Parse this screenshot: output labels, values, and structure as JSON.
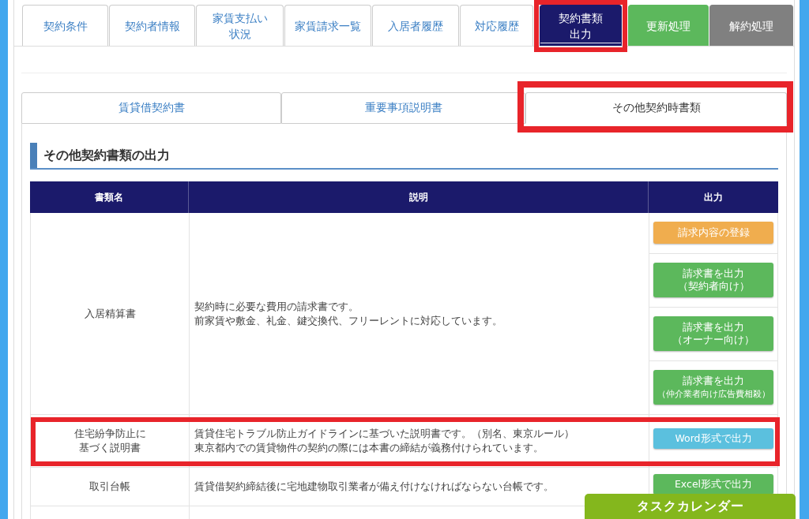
{
  "top_tabs": [
    {
      "label": "契約条件",
      "kind": "default",
      "selected": false,
      "highlighted": false
    },
    {
      "label": "契約者情報",
      "kind": "default",
      "selected": false,
      "highlighted": false
    },
    {
      "label": "家賃支払い状況",
      "kind": "default",
      "selected": false,
      "highlighted": false
    },
    {
      "label": "家賃請求一覧",
      "kind": "default",
      "selected": false,
      "highlighted": false
    },
    {
      "label": "入居者履歴",
      "kind": "default",
      "selected": false,
      "highlighted": false
    },
    {
      "label": "対応履歴",
      "kind": "default",
      "selected": false,
      "highlighted": false
    },
    {
      "label": "契約書類出力",
      "kind": "default",
      "selected": true,
      "highlighted": true
    },
    {
      "label": "更新処理",
      "kind": "success",
      "selected": false,
      "highlighted": false
    },
    {
      "label": "解約処理",
      "kind": "secondary",
      "selected": false,
      "highlighted": false
    }
  ],
  "document_tabs": [
    {
      "label": "賃貸借契約書",
      "selected": false,
      "highlighted": false
    },
    {
      "label": "重要事項説明書",
      "selected": false,
      "highlighted": false
    },
    {
      "label": "その他契約時書類",
      "selected": true,
      "highlighted": true
    }
  ],
  "section_title": "その他契約書類の出力",
  "table": {
    "columns": [
      "書類名",
      "説明",
      "出力"
    ],
    "rows": [
      {
        "name": "入居精算書",
        "description": [
          "契約時に必要な費用の請求書です。",
          "前家賃や敷金、礼金、鍵交換代、フリーレントに対応しています。"
        ],
        "highlighted": false,
        "outputs": [
          {
            "label": "請求内容の登録",
            "kind": "warning"
          },
          {
            "label": "請求書を出力",
            "note": "（契約者向け）",
            "kind": "success"
          },
          {
            "label": "請求書を出力",
            "note": "（オーナー向け）",
            "kind": "success"
          },
          {
            "label": "請求書を出力",
            "note": "（仲介業者向け広告費相殺）",
            "kind": "success"
          }
        ]
      },
      {
        "name": "住宅紛争防止に基づく説明書",
        "description": [
          "賃貸住宅トラブル防止ガイドラインに基づいた説明書です。（別名、東京ルール）",
          "東京都内での賃貸物件の契約の際には本書の締結が義務付けられています。"
        ],
        "highlighted": true,
        "outputs": [
          {
            "label": "Word形式で出力",
            "kind": "info"
          }
        ]
      },
      {
        "name": "取引台帳",
        "description": [
          "賃貸借契約締結後に宅地建物取引業者が備え付けなければならない台帳です。"
        ],
        "highlighted": false,
        "outputs": [
          {
            "label": "Excel形式で出力",
            "kind": "success"
          }
        ]
      }
    ]
  },
  "task_calendar": {
    "label": "タスクカレンダー"
  }
}
